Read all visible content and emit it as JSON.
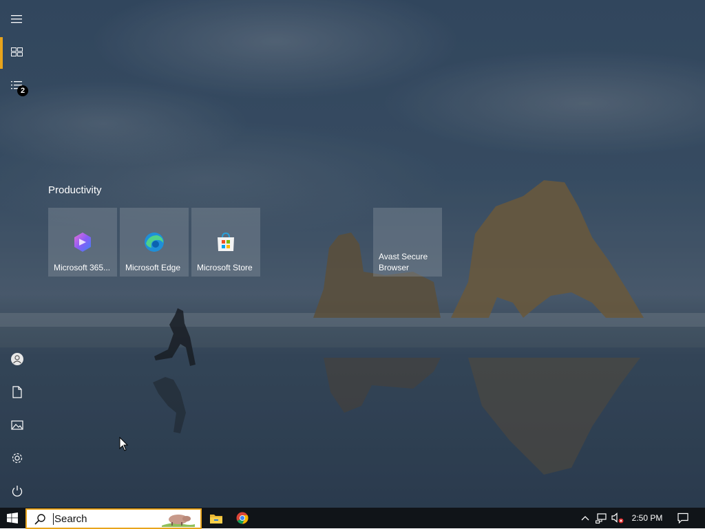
{
  "start_menu": {
    "group_title": "Productivity",
    "tiles": [
      {
        "label": "Microsoft 365..."
      },
      {
        "label": "Microsoft Edge"
      },
      {
        "label": "Microsoft Store"
      },
      {
        "label": "Avast Secure Browser"
      }
    ],
    "rail": {
      "badge_count": "2",
      "icons": [
        "hamburger-icon",
        "tiles-icon",
        "all-apps-icon",
        "user-icon",
        "documents-icon",
        "pictures-icon",
        "settings-icon",
        "power-icon"
      ]
    }
  },
  "taskbar": {
    "search_placeholder": "Search",
    "clock": "2:50 PM",
    "apps": [
      "file-explorer-icon",
      "chrome-icon"
    ],
    "tray": [
      "show-hidden-icons",
      "network-icon",
      "volume-muted-icon",
      "notifications-icon"
    ]
  },
  "colors": {
    "accent": "#e8a41c",
    "taskbar": "#101418"
  }
}
